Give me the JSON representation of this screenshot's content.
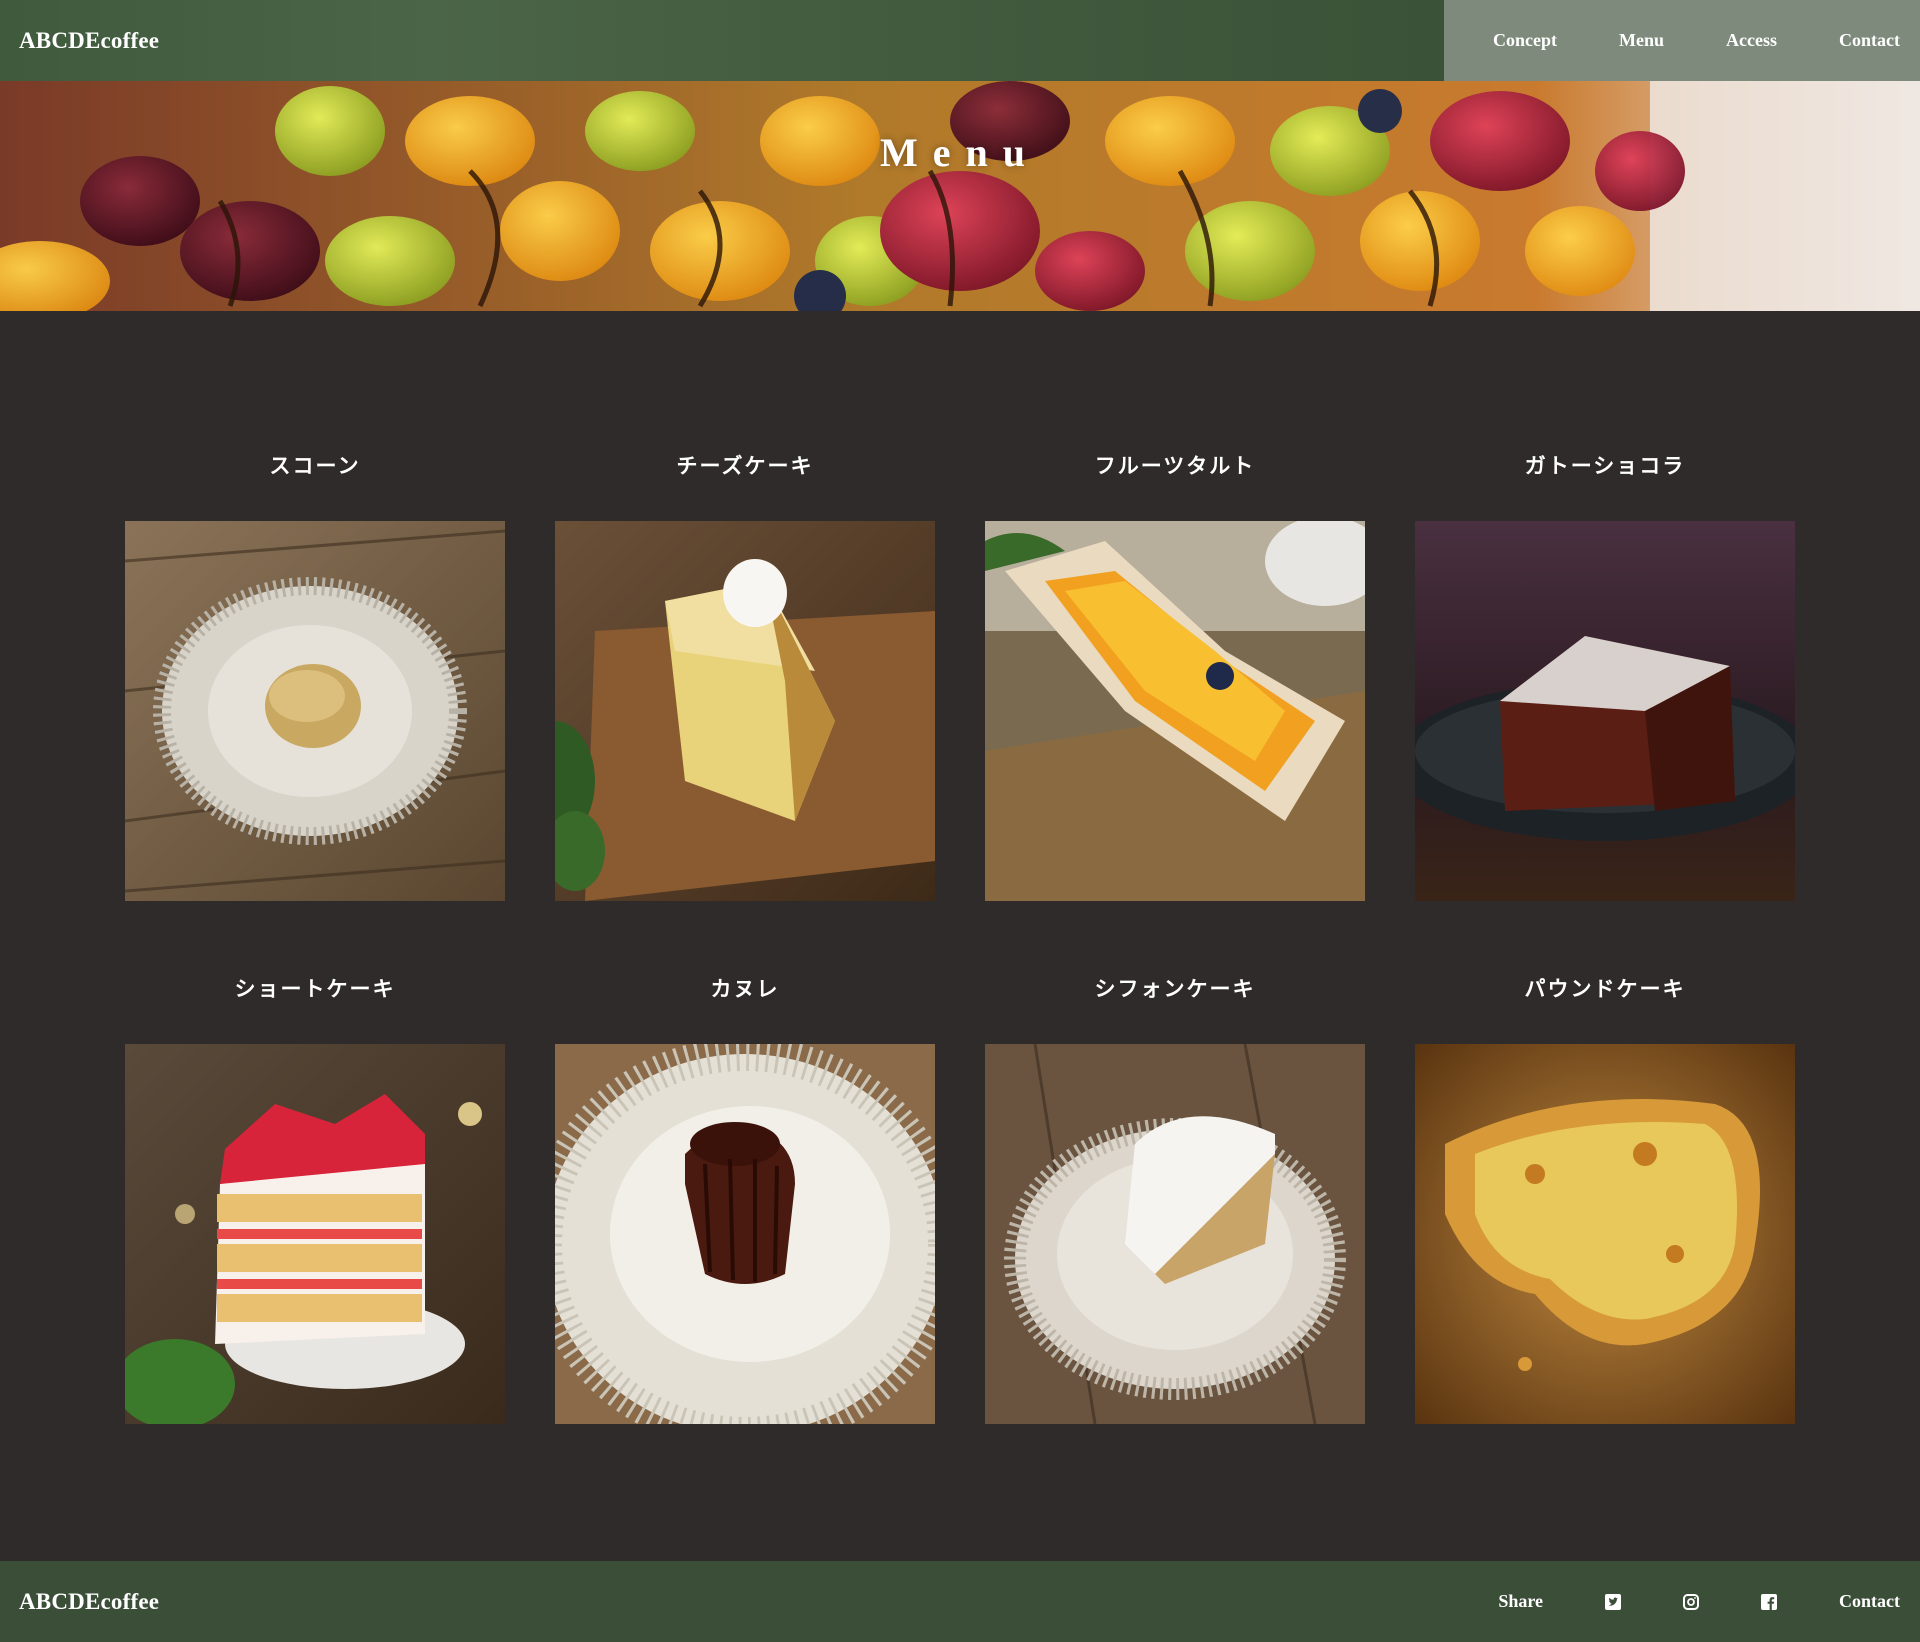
{
  "header": {
    "logo": "ABCDEcoffee",
    "nav": [
      {
        "label": "Concept"
      },
      {
        "label": "Menu"
      },
      {
        "label": "Access"
      },
      {
        "label": "Contact"
      }
    ]
  },
  "hero": {
    "title": "Menu"
  },
  "menu": {
    "items": [
      {
        "name": "スコーン",
        "photo": "scone"
      },
      {
        "name": "チーズケーキ",
        "photo": "cheesecake"
      },
      {
        "name": "フルーツタルト",
        "photo": "fruit-tart"
      },
      {
        "name": "ガトーショコラ",
        "photo": "gateau-chocolat"
      },
      {
        "name": "ショートケーキ",
        "photo": "shortcake"
      },
      {
        "name": "カヌレ",
        "photo": "canele"
      },
      {
        "name": "シフォンケーキ",
        "photo": "chiffon-cake"
      },
      {
        "name": "パウンドケーキ",
        "photo": "pound-cake"
      }
    ]
  },
  "footer": {
    "logo": "ABCDEcoffee",
    "share_label": "Share",
    "social": [
      "twitter-icon",
      "instagram-icon",
      "facebook-icon"
    ],
    "contact_label": "Contact"
  },
  "colors": {
    "background": "#2f2b2b",
    "header_green": "#445c40",
    "nav_gray_green": "#7e8a7b",
    "footer_green": "#3b4f38"
  }
}
